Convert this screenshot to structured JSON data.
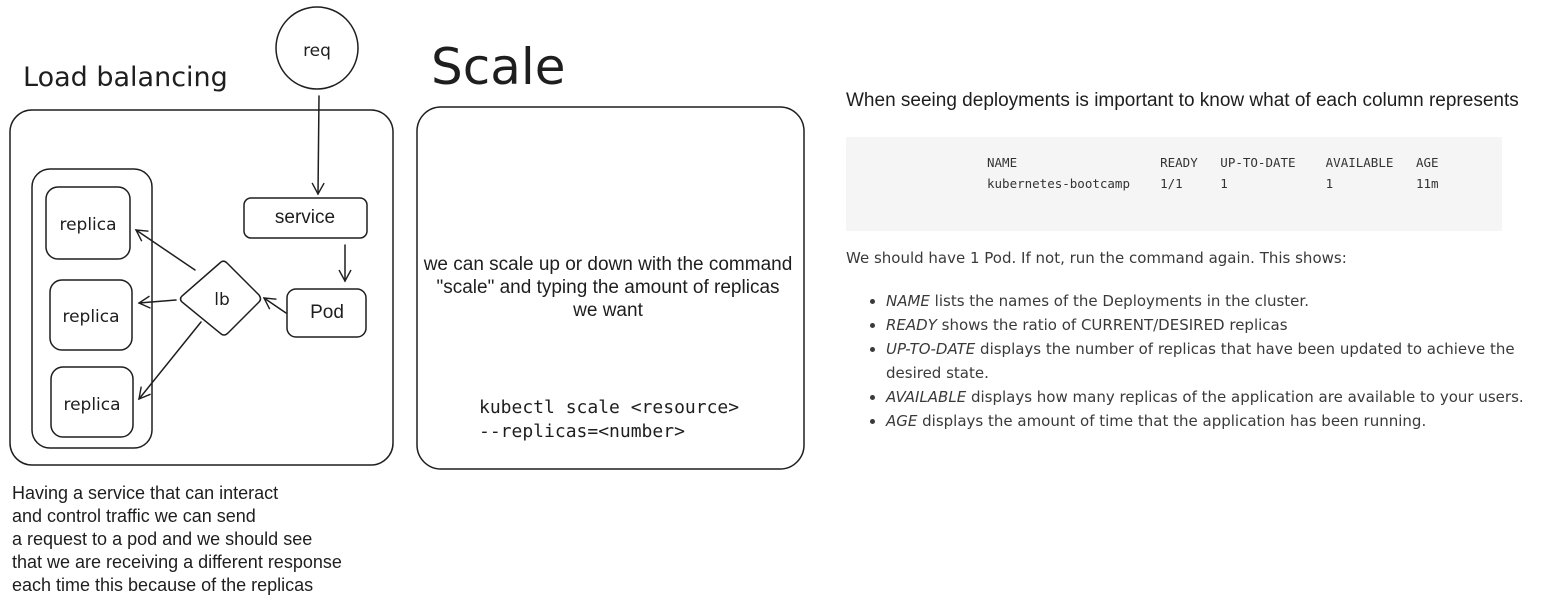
{
  "diagram": {
    "load_balancing_title": "Load balancing",
    "req_label": "req",
    "service_label": "service",
    "pod_label": "Pod",
    "lb_label": "lb",
    "replica_labels": [
      "replica",
      "replica",
      "replica"
    ],
    "lb_caption_lines": [
      "Having a service  that can interact",
      "and control traffic we can send",
      "a request to a pod and we should see",
      "that we are receiving a different response",
      "each time this because of the replicas"
    ],
    "scale_title": "Scale",
    "scale_description": "we can scale up or down with the command \"scale\" and typing the amount of replicas we want",
    "scale_command_lines": [
      "kubectl scale <resource>",
      "--replicas=<number>"
    ]
  },
  "doc": {
    "heading": "When seeing deployments is important to know what of each column represents",
    "table_header": [
      "NAME",
      "READY",
      "UP-TO-DATE",
      "AVAILABLE",
      "AGE"
    ],
    "table_row": [
      "kubernetes-bootcamp",
      "1/1",
      "1",
      "1",
      "11m"
    ],
    "paragraph": "We should have 1 Pod. If not, run the command again. This shows:",
    "bullets": [
      {
        "term": "NAME",
        "text": " lists the names of the Deployments in the cluster."
      },
      {
        "term": "READY",
        "text": " shows the ratio of CURRENT/DESIRED replicas"
      },
      {
        "term": "UP-TO-DATE",
        "text": " displays the number of replicas that have been updated to achieve the desired state."
      },
      {
        "term": "AVAILABLE",
        "text": " displays how many replicas of the application are available to your users."
      },
      {
        "term": "AGE",
        "text": " displays the amount of time that the application has been running."
      }
    ]
  }
}
